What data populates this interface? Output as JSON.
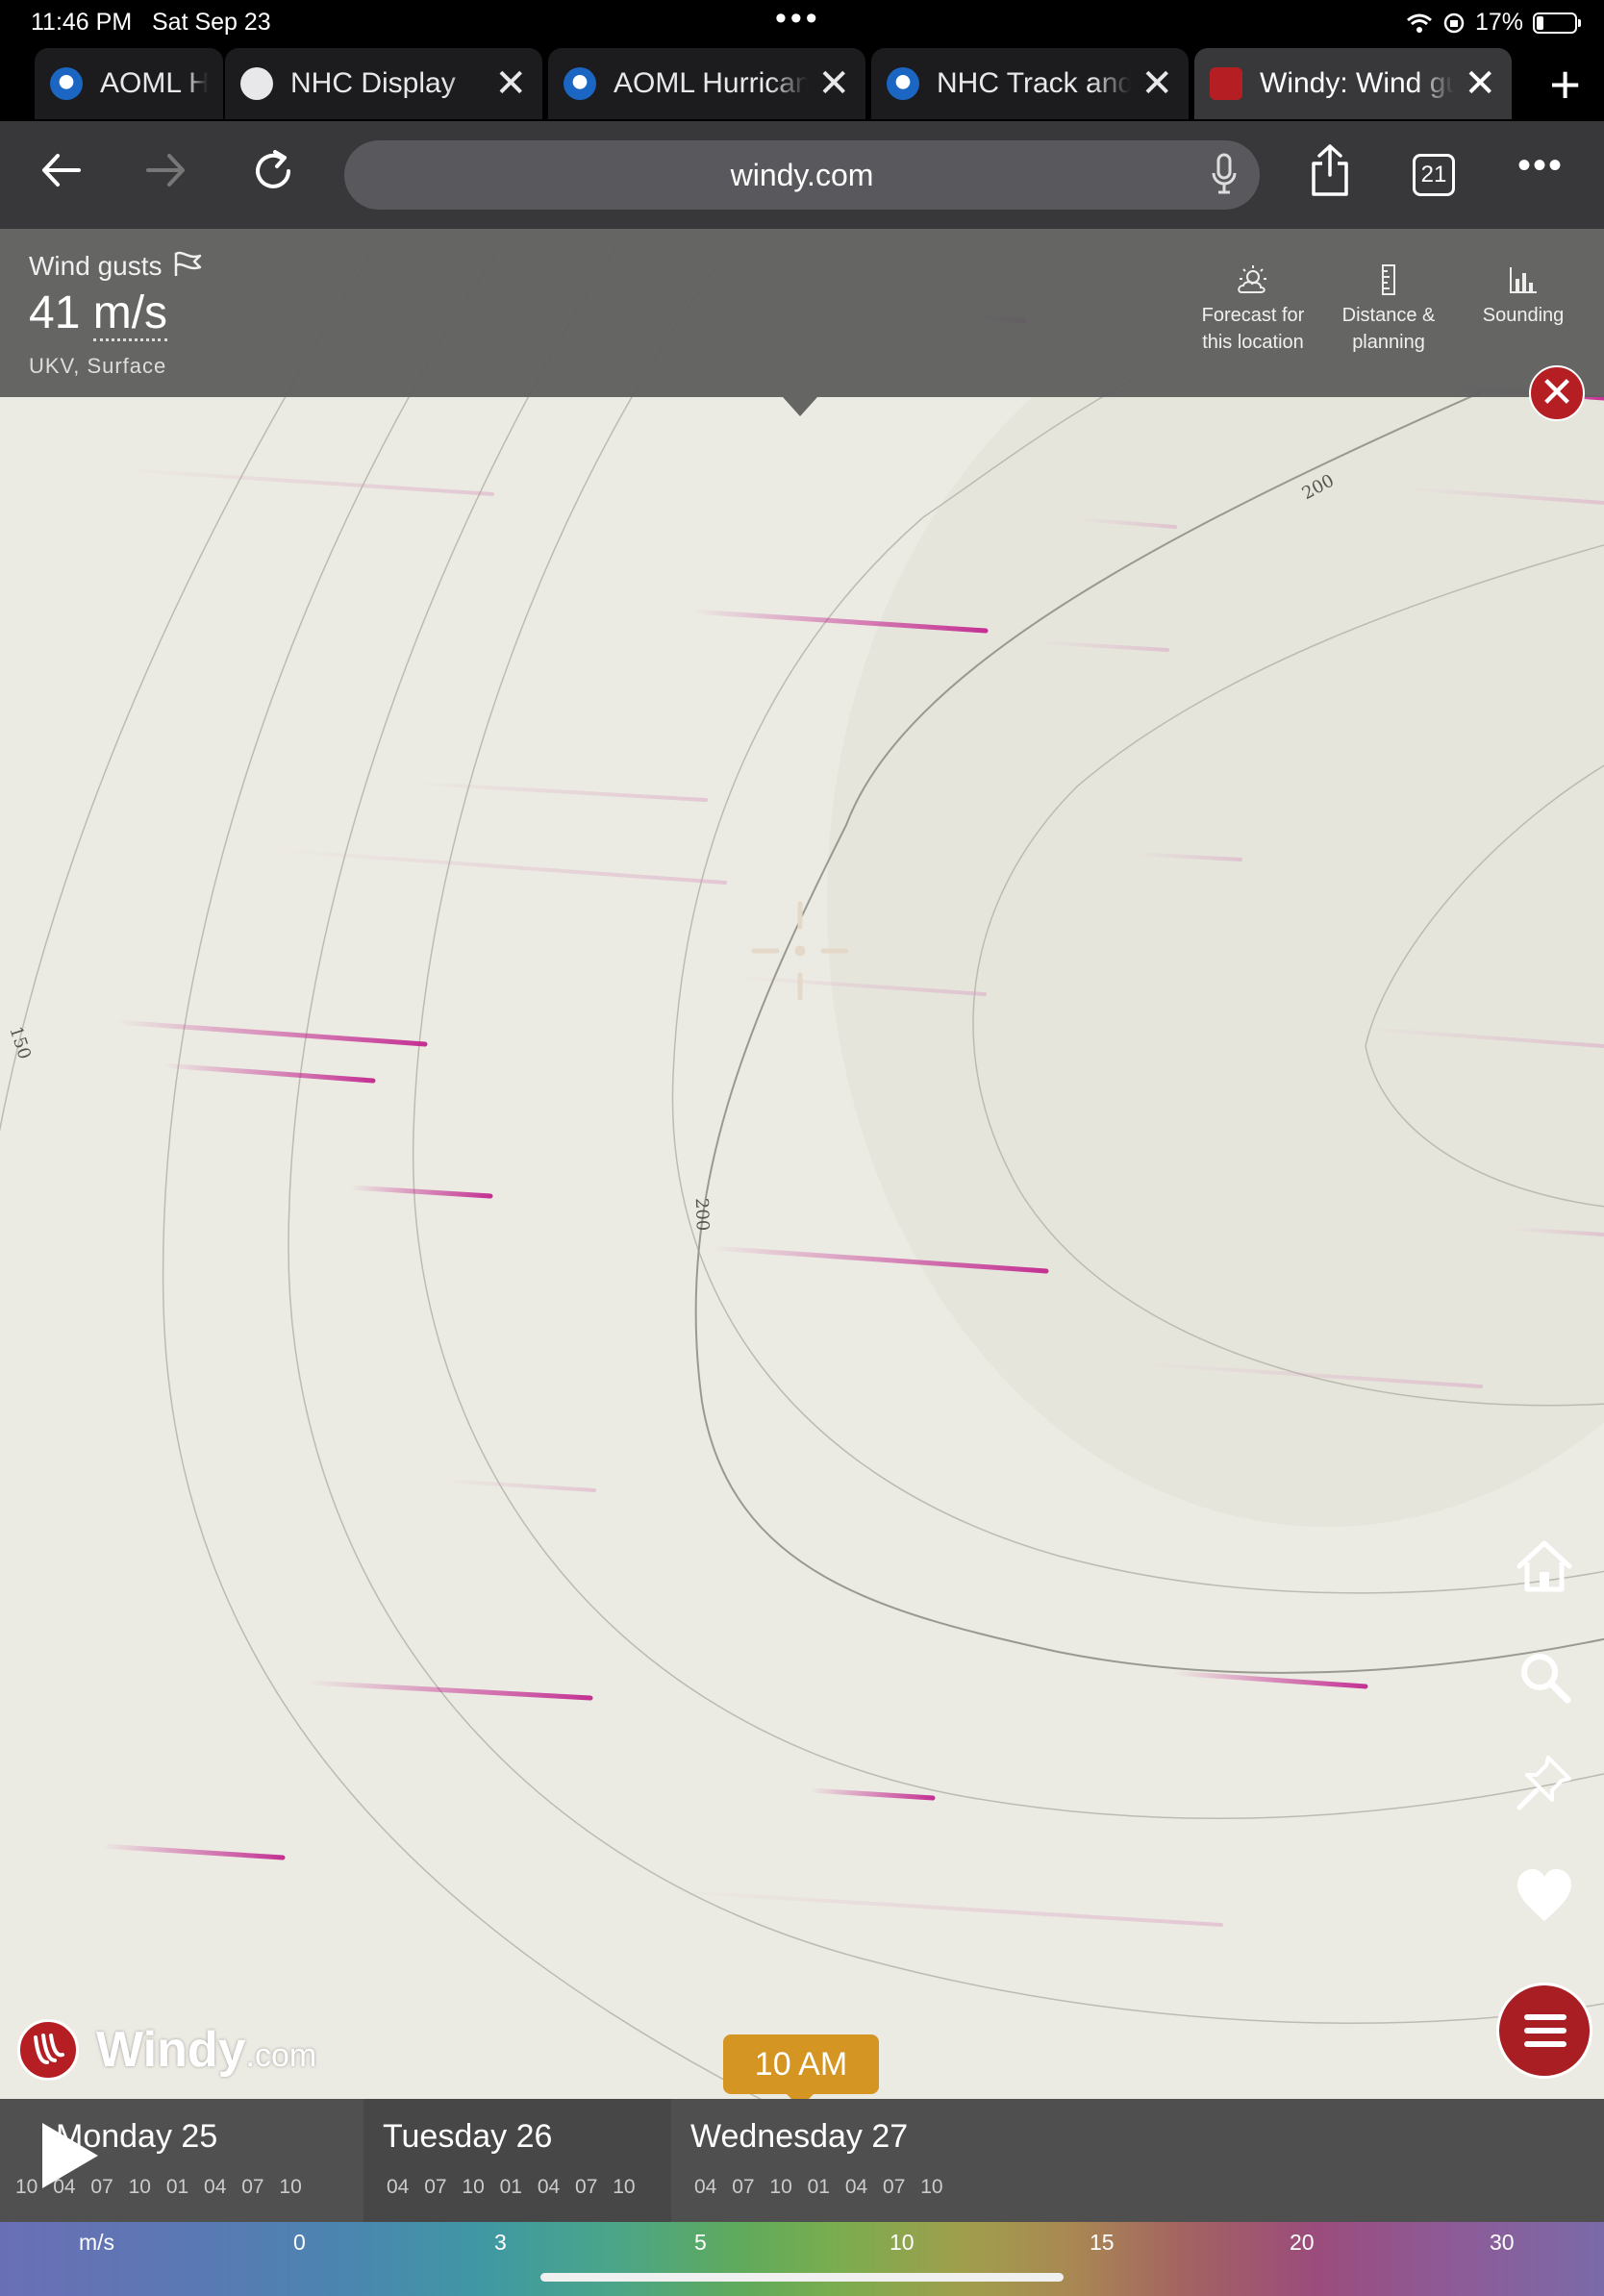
{
  "status_bar": {
    "time": "11:46 PM",
    "date": "Sat Sep 23",
    "battery": "17%"
  },
  "tabs": [
    {
      "label": "AOML H",
      "icon": "noaa-icon",
      "active": false
    },
    {
      "label": "NHC Display",
      "icon": "globe-icon",
      "active": false
    },
    {
      "label": "AOML Hurrican",
      "icon": "noaa-icon",
      "active": false
    },
    {
      "label": "NHC Track and",
      "icon": "noaa-icon",
      "active": false
    },
    {
      "label": "Windy: Wind gu",
      "icon": "windy-icon",
      "active": true
    }
  ],
  "toolbar": {
    "url": "windy.com",
    "tab_count": "21"
  },
  "info_panel": {
    "layer": "Wind gusts",
    "value": "41",
    "unit": "m/s",
    "model": "UKV, Surface",
    "tools": [
      {
        "label_line1": "Forecast for",
        "label_line2": "this location",
        "icon": "forecast-icon"
      },
      {
        "label_line1": "Distance &",
        "label_line2": "planning",
        "icon": "ruler-icon"
      },
      {
        "label_line1": "Sounding",
        "label_line2": "",
        "icon": "sounding-icon"
      }
    ]
  },
  "map": {
    "contour_labels": [
      "200",
      "150",
      "200"
    ]
  },
  "logo": {
    "brand": "Windy",
    "suffix": ".com"
  },
  "timeline": {
    "current_time": "10 AM",
    "days": [
      {
        "name": "Monday 25",
        "hours": [
          "10",
          "04",
          "07",
          "10",
          "01",
          "04",
          "07",
          "10"
        ]
      },
      {
        "name": "Tuesday 26",
        "hours": [
          "04",
          "07",
          "10",
          "01",
          "04",
          "07",
          "10"
        ]
      },
      {
        "name": "Wednesday 27",
        "hours": [
          "04",
          "07",
          "10",
          "01",
          "04",
          "07",
          "10"
        ]
      }
    ]
  },
  "legend": {
    "unit": "m/s",
    "ticks": [
      "0",
      "3",
      "5",
      "10",
      "15",
      "20",
      "30"
    ]
  },
  "colors": {
    "accent": "#b51f24",
    "time_bubble": "#d49522",
    "map_bg": "#ecebe3",
    "streak": "#c2278f"
  }
}
